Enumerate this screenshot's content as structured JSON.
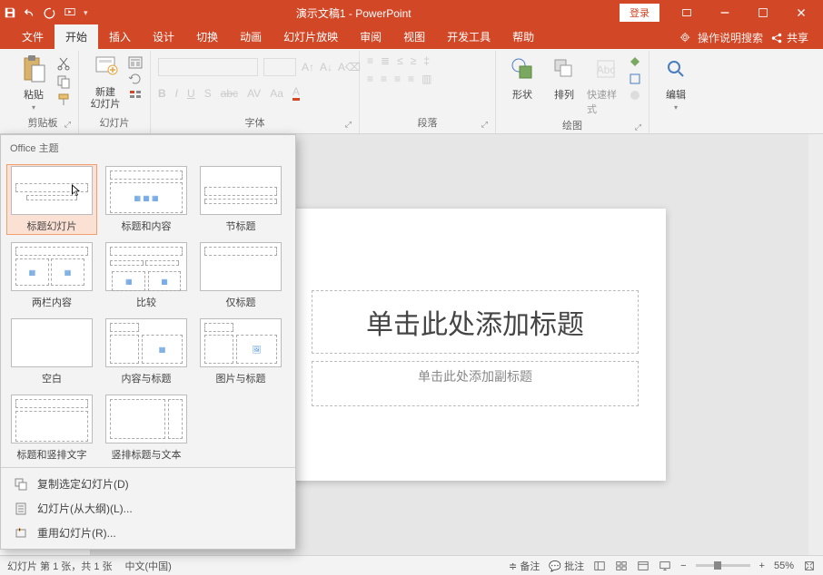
{
  "app": {
    "title": "演示文稿1  -  PowerPoint",
    "login": "登录",
    "share": "共享"
  },
  "tabs": [
    "文件",
    "开始",
    "插入",
    "设计",
    "切换",
    "动画",
    "幻灯片放映",
    "审阅",
    "视图",
    "开发工具",
    "帮助"
  ],
  "active_tab": "开始",
  "search_hint": "操作说明搜索",
  "ribbon": {
    "clipboard": {
      "paste": "粘贴",
      "label": "剪贴板"
    },
    "slides": {
      "new_slide": "新建\n幻灯片",
      "label": "幻灯片"
    },
    "font": {
      "label": "字体"
    },
    "paragraph": {
      "label": "段落"
    },
    "drawing": {
      "shapes": "形状",
      "arrange": "排列",
      "quick_styles": "快速样式",
      "label": "绘图"
    },
    "editing": {
      "edit": "编辑"
    }
  },
  "gallery": {
    "header": "Office 主题",
    "layouts": [
      "标题幻灯片",
      "标题和内容",
      "节标题",
      "两栏内容",
      "比较",
      "仅标题",
      "空白",
      "内容与标题",
      "图片与标题",
      "标题和竖排文字",
      "竖排标题与文本"
    ],
    "menu": {
      "duplicate": "复制选定幻灯片(D)",
      "from_outline": "幻灯片(从大纲)(L)...",
      "reuse": "重用幻灯片(R)..."
    }
  },
  "slide": {
    "title_placeholder": "单击此处添加标题",
    "subtitle_placeholder": "单击此处添加副标题"
  },
  "status": {
    "slide_info": "幻灯片 第 1 张，共 1 张",
    "language": "中文(中国)",
    "notes": "备注",
    "comments": "批注",
    "zoom": "55%"
  },
  "colors": {
    "accent": "#d24726"
  }
}
